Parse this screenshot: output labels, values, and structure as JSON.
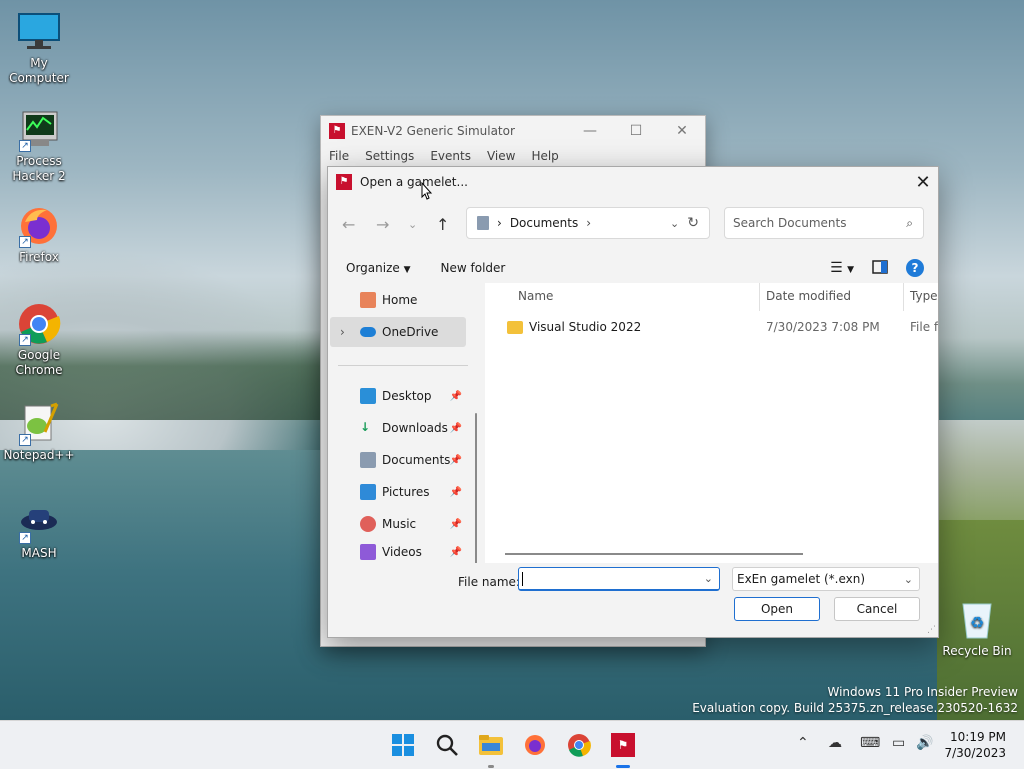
{
  "desktop": {
    "icons": [
      {
        "label": "My Computer"
      },
      {
        "label": "Process Hacker 2"
      },
      {
        "label": "Firefox"
      },
      {
        "label": "Google Chrome"
      },
      {
        "label": "Notepad++"
      },
      {
        "label": "MASH"
      }
    ],
    "recycle_bin": "Recycle Bin",
    "watermark_line1": "Windows 11 Pro Insider Preview",
    "watermark_line2": "Evaluation copy. Build 25375.zn_release.230520-1632"
  },
  "bg_window": {
    "title": "EXEN-V2 Generic Simulator",
    "menu": [
      "File",
      "Settings",
      "Events",
      "View",
      "Help"
    ]
  },
  "dialog": {
    "title": "Open a gamelet...",
    "address": {
      "crumb": "Documents"
    },
    "search_placeholder": "Search Documents",
    "organize": "Organize",
    "new_folder": "New folder",
    "nav": {
      "home": "Home",
      "onedrive": "OneDrive",
      "desktop": "Desktop",
      "downloads": "Downloads",
      "documents": "Documents",
      "pictures": "Pictures",
      "music": "Music",
      "videos": "Videos"
    },
    "columns": {
      "name": "Name",
      "date": "Date modified",
      "type": "Type"
    },
    "rows": [
      {
        "name": "Visual Studio 2022",
        "date": "7/30/2023 7:08 PM",
        "type": "File fo"
      }
    ],
    "filename_label": "File name:",
    "filename_value": "",
    "filetype": "ExEn gamelet (*.exn)",
    "open": "Open",
    "cancel": "Cancel"
  },
  "taskbar": {
    "time": "10:19 PM",
    "date": "7/30/2023"
  }
}
